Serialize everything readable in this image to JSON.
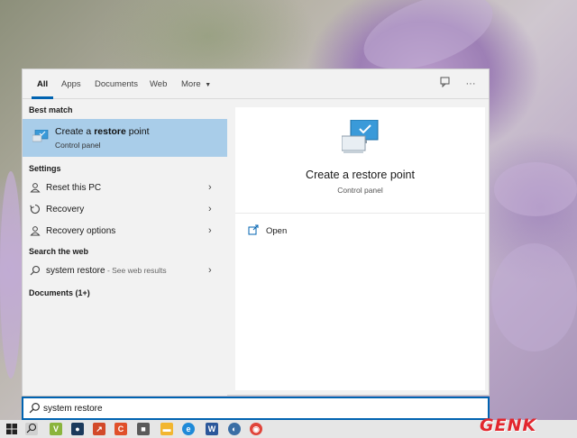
{
  "tabs": [
    "All",
    "Apps",
    "Documents",
    "Web",
    "More"
  ],
  "toolbar": {
    "feedback_icon": "feedback-icon",
    "more_icon": "ellipsis-icon"
  },
  "left": {
    "best_match_header": "Best match",
    "best_match": {
      "title_prefix": "Create a ",
      "title_bold": "restore",
      "title_suffix": " point",
      "subtitle": "Control panel"
    },
    "settings_header": "Settings",
    "settings": [
      {
        "label": "Reset this PC",
        "icon": "person-icon"
      },
      {
        "label": "Recovery",
        "icon": "recovery-icon"
      },
      {
        "label": "Recovery options",
        "icon": "person-icon"
      }
    ],
    "web_header": "Search the web",
    "web_item": {
      "label": "system restore",
      "suffix": " - See web results"
    },
    "documents_header": "Documents (1+)"
  },
  "right": {
    "title": "Create a restore point",
    "subtitle": "Control panel",
    "action_open": "Open"
  },
  "search": {
    "value": "system restore"
  },
  "taskbar": {
    "icons": [
      "windows-start-icon",
      "search-icon",
      "vivaldi-icon",
      "steam-icon",
      "app-icon",
      "ccleaner-icon",
      "app-icon",
      "file-explorer-icon",
      "edge-icon",
      "word-icon",
      "app-icon",
      "chrome-icon"
    ]
  },
  "watermark": "GENK",
  "colors": {
    "accent": "#0063b1",
    "highlight": "#a9cde9",
    "panel_bg": "#f2f2f2"
  }
}
